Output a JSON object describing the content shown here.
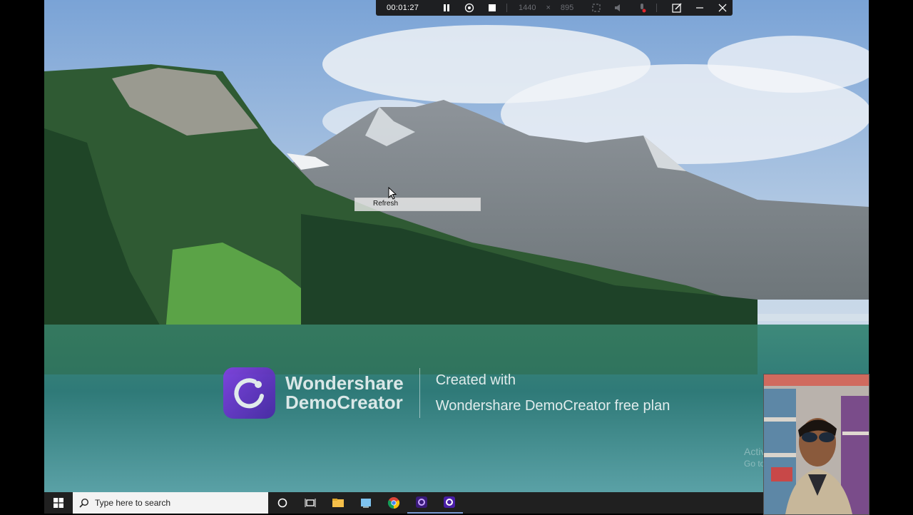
{
  "recorder": {
    "elapsed": "00:01:27",
    "width": "1440",
    "times": "×",
    "height": "895"
  },
  "context_menu": {
    "items": [
      "Refresh"
    ]
  },
  "watermark": {
    "brand_line1": "Wondershare",
    "brand_line2": "DemoCreator",
    "text_line1": "Created with",
    "text_line2": "Wondershare DemoCreator free plan"
  },
  "activation": {
    "line1": "Activate Win",
    "line2": "Go to Settings to"
  },
  "taskbar": {
    "search_placeholder": "Type here to search",
    "pinned": [
      "cortana-icon",
      "task-view-icon",
      "file-explorer-icon",
      "explorer-app-icon",
      "chrome-icon",
      "democreator-icon",
      "democreator-recorder-icon"
    ]
  },
  "colors": {
    "taskbar": "#202020",
    "recorder_bar": "#1e1f22",
    "accent_purple": "#7b35e6"
  }
}
